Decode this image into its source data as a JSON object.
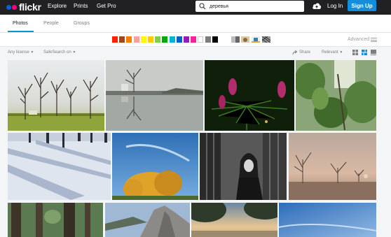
{
  "header": {
    "logo": "flickr",
    "nav": [
      "Explore",
      "Prints",
      "Get Pro"
    ],
    "search": {
      "value": "деревья"
    },
    "login": "Log In",
    "signup": "Sign Up"
  },
  "tabs": [
    {
      "label": "Photos",
      "active": true
    },
    {
      "label": "People",
      "active": false
    },
    {
      "label": "Groups",
      "active": false
    }
  ],
  "color_filters": [
    "#ff2000",
    "#a24615",
    "#ff7c00",
    "#ff9f9c",
    "#fffa00",
    "#ffcc00",
    "#7bd148",
    "#00ab00",
    "#00b2d4",
    "#0062c6",
    "#8c20ba",
    "#f52394",
    "#ffffff",
    "#7c7c7c",
    "#000000"
  ],
  "advanced_label": "Advanced",
  "filters": {
    "license": "Any license",
    "safesearch": "SafeSearch on",
    "share": "Share",
    "sort": "Relevant"
  },
  "photos": [
    {
      "name": "park-trees-bare",
      "icon": "bare-trees-park"
    },
    {
      "name": "pond-reflection",
      "icon": "tree-reflection"
    },
    {
      "name": "spruce-cones",
      "icon": "pink-cones"
    },
    {
      "name": "green-leaves",
      "icon": "leaves"
    },
    {
      "name": "snow-shadows",
      "icon": "snow-forest"
    },
    {
      "name": "autumn-tree-sky",
      "icon": "yellow-tree"
    },
    {
      "name": "bw-woman-tree",
      "icon": "bw-portrait"
    },
    {
      "name": "foggy-field-trees",
      "icon": "foggy-trees"
    },
    {
      "name": "forest-trunks",
      "icon": "forest"
    },
    {
      "name": "rocky-cliff",
      "icon": "cliff"
    },
    {
      "name": "sunset-lake",
      "icon": "lake"
    },
    {
      "name": "blue-sky",
      "icon": "sky"
    }
  ]
}
